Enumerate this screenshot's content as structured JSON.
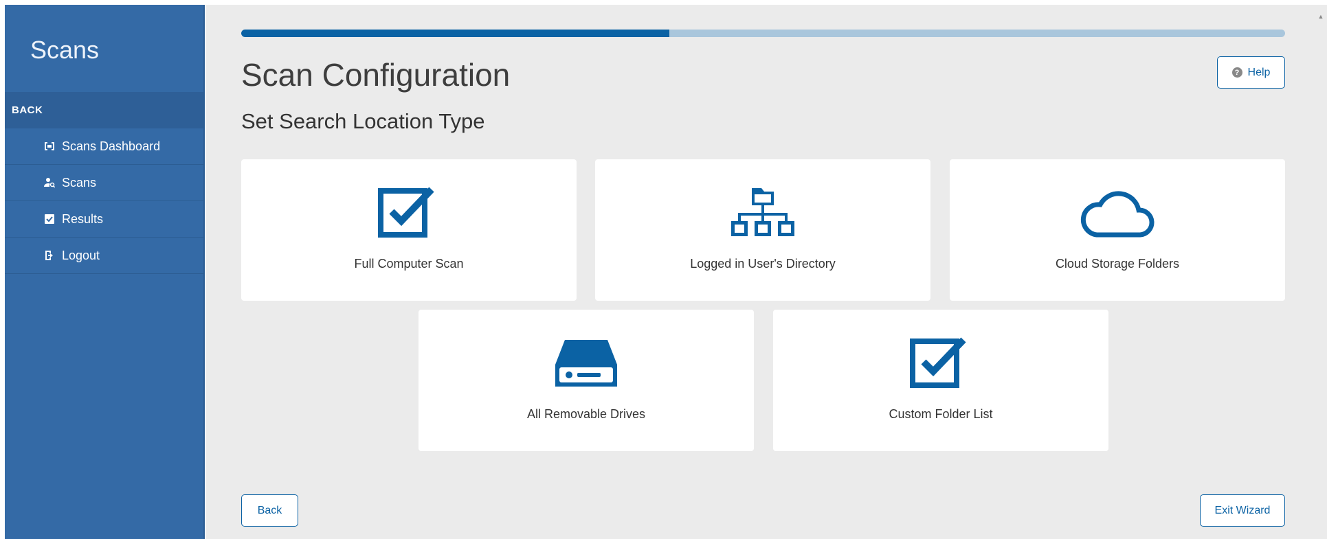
{
  "sidebar": {
    "title": "Scans",
    "back_label": "BACK",
    "items": [
      {
        "label": "Scans Dashboard",
        "icon": "dashboard-icon"
      },
      {
        "label": "Scans",
        "icon": "user-search-icon"
      },
      {
        "label": "Results",
        "icon": "checkbox-icon"
      },
      {
        "label": "Logout",
        "icon": "logout-icon"
      }
    ]
  },
  "main": {
    "progress": 0.41,
    "title": "Scan Configuration",
    "subtitle": "Set Search Location Type",
    "help_label": "Help",
    "cards": [
      {
        "label": "Full Computer Scan",
        "icon": "checkbox-icon"
      },
      {
        "label": "Logged in User's Directory",
        "icon": "folder-tree-icon"
      },
      {
        "label": "Cloud Storage Folders",
        "icon": "cloud-icon"
      },
      {
        "label": "All Removable Drives",
        "icon": "drive-icon"
      },
      {
        "label": "Custom Folder List",
        "icon": "checkbox-icon"
      }
    ],
    "back_label": "Back",
    "exit_label": "Exit Wizard"
  },
  "colors": {
    "sidebar_bg": "#346aa6",
    "accent": "#0b62a4",
    "progress_track": "#a9c6dc",
    "main_bg": "#ebebeb"
  }
}
